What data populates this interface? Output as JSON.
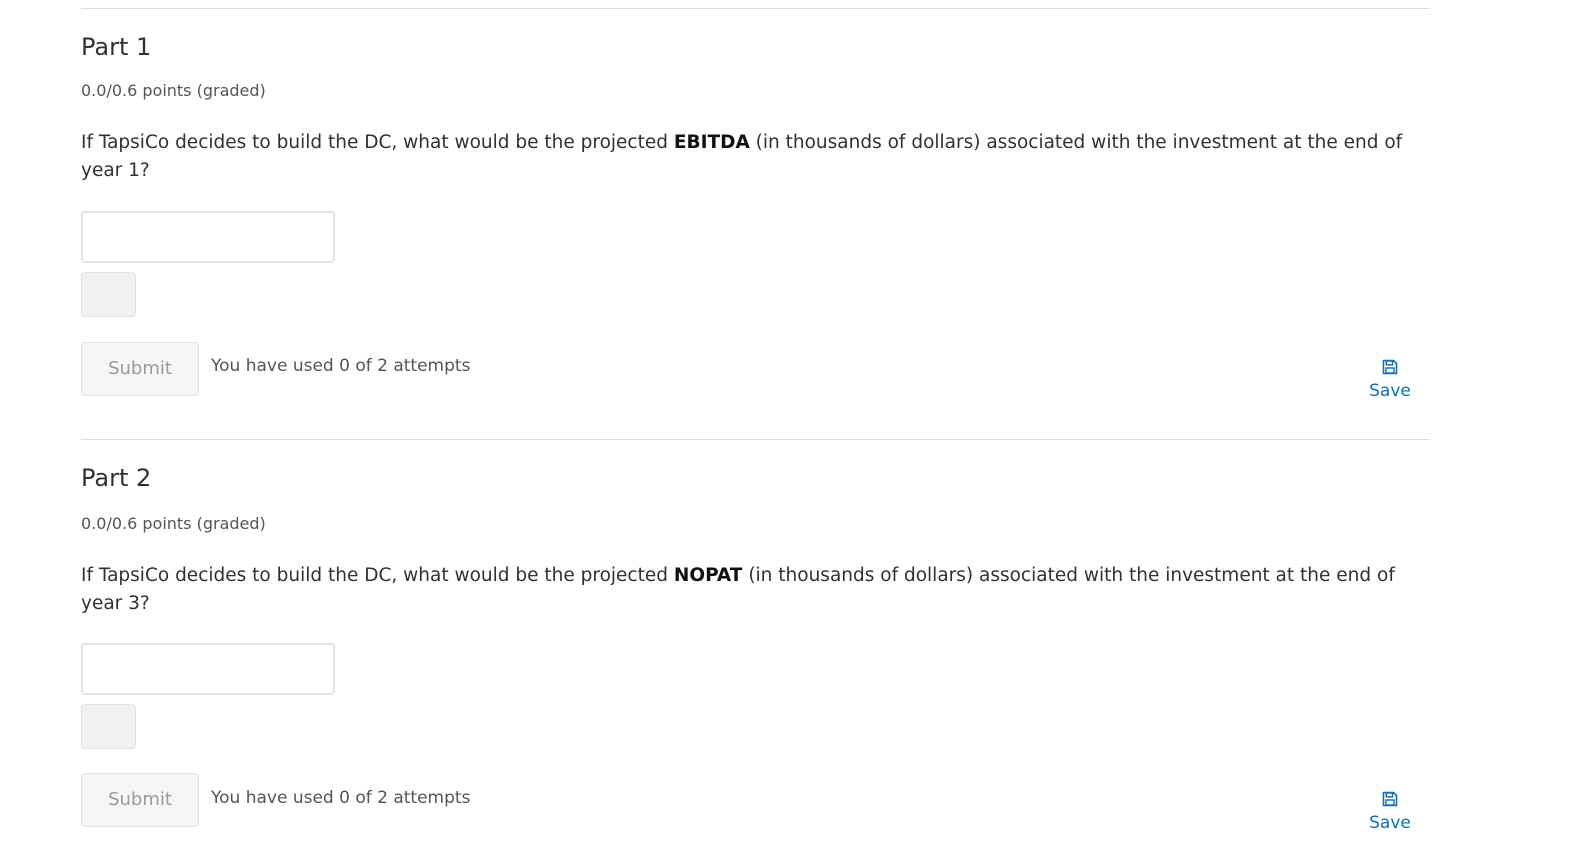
{
  "parts": [
    {
      "title": "Part 1",
      "points": "0.0/0.6 points (graded)",
      "question_before": "If TapsiCo decides to build the DC, what would be the projected ",
      "question_bold": "EBITDA",
      "question_after": " (in thousands of dollars) associated with the investment at the end of year 1?",
      "answer_value": "",
      "submit_label": "Submit",
      "attempts_text": "You have used 0 of 2 attempts",
      "save_label": "Save",
      "save_icon": "floppy-disk-icon"
    },
    {
      "title": "Part 2",
      "points": "0.0/0.6 points (graded)",
      "question_before": "If TapsiCo decides to build the DC, what would be the projected ",
      "question_bold": "NOPAT",
      "question_after": " (in thousands of dollars) associated with the investment at the end of year 3?",
      "answer_value": "",
      "submit_label": "Submit",
      "attempts_text": "You have used 0 of 2 attempts",
      "save_label": "Save",
      "save_icon": "floppy-disk-icon"
    }
  ],
  "colors": {
    "accent": "#0a70b4",
    "text": "#313131",
    "muted": "#555555",
    "disabled_text": "#9a9a9a"
  }
}
